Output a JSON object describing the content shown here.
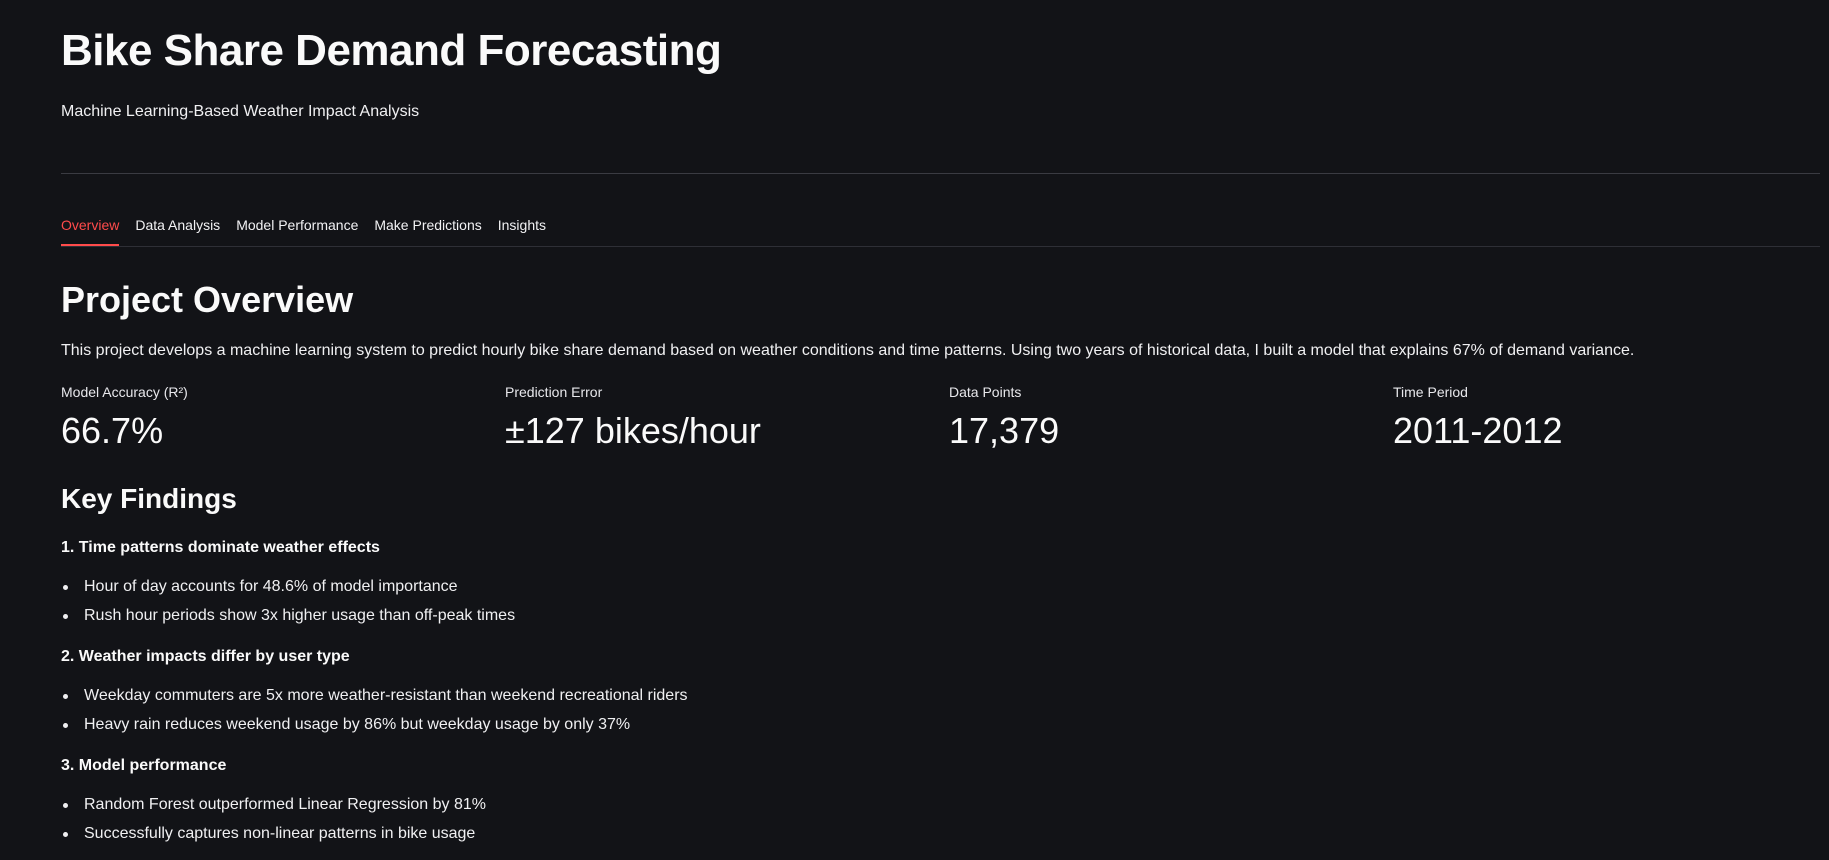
{
  "header": {
    "title": "Bike Share Demand Forecasting",
    "subtitle": "Machine Learning-Based Weather Impact Analysis"
  },
  "tabs": [
    {
      "label": "Overview",
      "active": true
    },
    {
      "label": "Data Analysis",
      "active": false
    },
    {
      "label": "Model Performance",
      "active": false
    },
    {
      "label": "Make Predictions",
      "active": false
    },
    {
      "label": "Insights",
      "active": false
    }
  ],
  "overview": {
    "title": "Project Overview",
    "intro": "This project develops a machine learning system to predict hourly bike share demand based on weather conditions and time patterns. Using two years of historical data, I built a model that explains 67% of demand variance.",
    "metrics": [
      {
        "label": "Model Accuracy (R²)",
        "value": "66.7%"
      },
      {
        "label": "Prediction Error",
        "value": "±127 bikes/hour"
      },
      {
        "label": "Data Points",
        "value": "17,379"
      },
      {
        "label": "Time Period",
        "value": "2011-2012"
      }
    ]
  },
  "findings": {
    "title": "Key Findings",
    "groups": [
      {
        "heading": "1. Time patterns dominate weather effects",
        "items": [
          "Hour of day accounts for 48.6% of model importance",
          "Rush hour periods show 3x higher usage than off-peak times"
        ]
      },
      {
        "heading": "2. Weather impacts differ by user type",
        "items": [
          "Weekday commuters are 5x more weather-resistant than weekend recreational riders",
          "Heavy rain reduces weekend usage by 86% but weekday usage by only 37%"
        ]
      },
      {
        "heading": "3. Model performance",
        "items": [
          "Random Forest outperformed Linear Regression by 81%",
          "Successfully captures non-linear patterns in bike usage"
        ]
      }
    ]
  },
  "colors": {
    "background": "#121317",
    "accent": "#ff4b4b",
    "text": "#fafafa"
  }
}
